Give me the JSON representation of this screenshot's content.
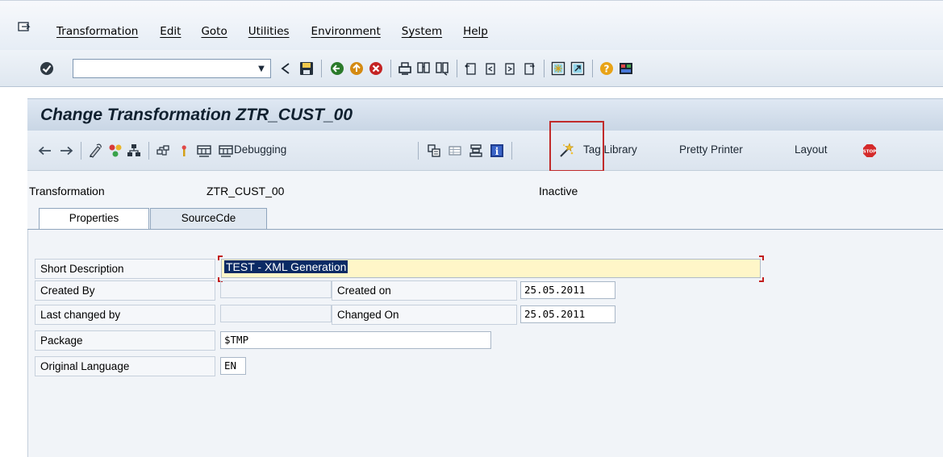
{
  "menubar": {
    "icon": "menu-enter-icon",
    "items": [
      "Transformation",
      "Edit",
      "Goto",
      "Utilities",
      "Environment",
      "System",
      "Help"
    ]
  },
  "std_toolbar": {
    "command_field_value": "",
    "icons": [
      "enter-icon",
      "dropdown-arrow-icon",
      "history-back-icon",
      "save-icon",
      "back-icon",
      "exit-icon",
      "cancel-icon",
      "print-icon",
      "find-icon",
      "find-next-icon",
      "first-page-icon",
      "previous-page-icon",
      "next-page-icon",
      "last-page-icon",
      "new-session-icon",
      "shortcut-icon",
      "help-icon",
      "customize-layout-icon"
    ]
  },
  "title": "Change Transformation ZTR_CUST_00",
  "app_toolbar": {
    "debugging_label": "Debugging",
    "tag_library_label": "Tag Library",
    "pretty_printer_label": "Pretty Printer",
    "layout_label": "Layout"
  },
  "header": {
    "transformation_label": "Transformation",
    "transformation_value": "ZTR_CUST_00",
    "status": "Inactive"
  },
  "tabs": [
    "Properties",
    "SourceCde"
  ],
  "form": {
    "short_description_label": "Short Description",
    "short_description_value": "TEST - XML Generation",
    "created_by_label": "Created By",
    "created_by_value": "",
    "created_on_label": "Created on",
    "created_on_value": "25.05.2011",
    "last_changed_by_label": "Last changed by",
    "last_changed_by_value": "",
    "changed_on_label": "Changed On",
    "changed_on_value": "25.05.2011",
    "package_label": "Package",
    "package_value": "$TMP",
    "original_language_label": "Original Language",
    "original_language_value": "EN"
  },
  "colors": {
    "highlight_box": "#c12a2a",
    "selection": "#0a2a64",
    "input_focus": "#fff6c8"
  }
}
